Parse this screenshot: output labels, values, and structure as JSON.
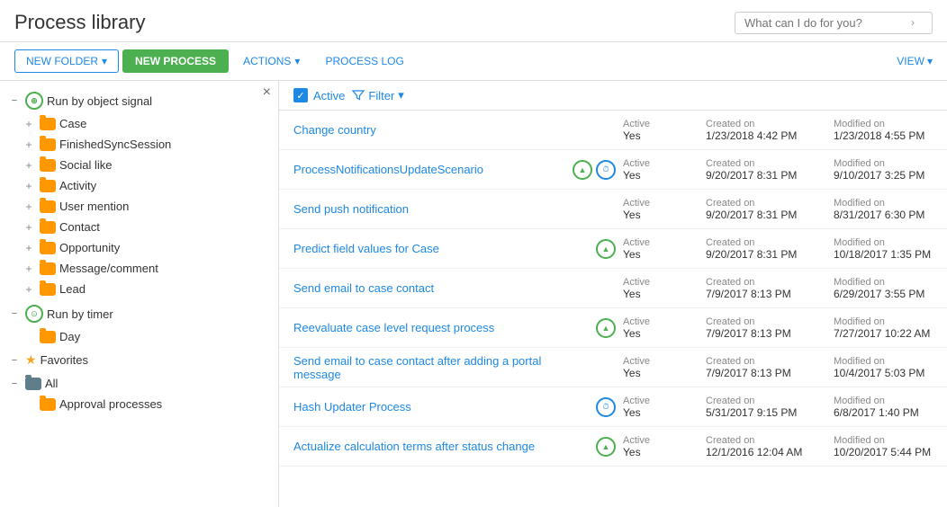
{
  "header": {
    "title": "Process library",
    "search_placeholder": "What can I do for you?"
  },
  "toolbar": {
    "new_folder": "NEW FOLDER",
    "new_process": "NEW PROCESS",
    "actions": "ACTIONS",
    "process_log": "PROCESS LOG",
    "view": "VIEW"
  },
  "filter": {
    "active_label": "Active",
    "filter_label": "Filter"
  },
  "sidebar": {
    "close_icon": "×",
    "groups": [
      {
        "id": "run-by-object-signal",
        "label": "Run by object signal",
        "expanded": true,
        "type": "signal",
        "children": [
          {
            "label": "Case"
          },
          {
            "label": "FinishedSyncSession"
          },
          {
            "label": "Social like"
          },
          {
            "label": "Activity"
          },
          {
            "label": "User mention"
          },
          {
            "label": "Contact"
          },
          {
            "label": "Opportunity"
          },
          {
            "label": "Message/comment"
          },
          {
            "label": "Lead"
          }
        ]
      },
      {
        "id": "run-by-timer",
        "label": "Run by timer",
        "expanded": true,
        "type": "timer",
        "children": [
          {
            "label": "Day"
          }
        ]
      },
      {
        "id": "favorites",
        "label": "Favorites",
        "type": "favorites",
        "expanded": false,
        "children": []
      },
      {
        "id": "all",
        "label": "All",
        "type": "all",
        "expanded": true,
        "children": [
          {
            "label": "Approval processes"
          }
        ]
      }
    ]
  },
  "processes": [
    {
      "name": "Change country",
      "icons": [],
      "active": "Yes",
      "created_label": "Created on",
      "created": "1/23/2018 4:42 PM",
      "modified_label": "Modified on",
      "modified": "1/23/2018 4:55 PM"
    },
    {
      "name": "ProcessNotificationsUpdateScenario",
      "icons": [
        "triangle-green",
        "clock-blue"
      ],
      "active": "Yes",
      "created_label": "Created on",
      "created": "9/20/2017 8:31 PM",
      "modified_label": "Modified on",
      "modified": "9/10/2017 3:25 PM"
    },
    {
      "name": "Send push notification",
      "icons": [],
      "active": "Yes",
      "created_label": "Created on",
      "created": "9/20/2017 8:31 PM",
      "modified_label": "Modified on",
      "modified": "8/31/2017 6:30 PM"
    },
    {
      "name": "Predict field values for Case",
      "icons": [
        "triangle-green"
      ],
      "active": "Yes",
      "created_label": "Created on",
      "created": "9/20/2017 8:31 PM",
      "modified_label": "Modified on",
      "modified": "10/18/2017 1:35 PM"
    },
    {
      "name": "Send email to case contact",
      "icons": [],
      "active": "Yes",
      "created_label": "Created on",
      "created": "7/9/2017 8:13 PM",
      "modified_label": "Modified on",
      "modified": "6/29/2017 3:55 PM"
    },
    {
      "name": "Reevaluate case level request process",
      "icons": [
        "triangle-green"
      ],
      "active": "Yes",
      "created_label": "Created on",
      "created": "7/9/2017 8:13 PM",
      "modified_label": "Modified on",
      "modified": "7/27/2017 10:22 AM"
    },
    {
      "name": "Send email to case contact after adding a portal message",
      "icons": [],
      "active": "Yes",
      "created_label": "Created on",
      "created": "7/9/2017 8:13 PM",
      "modified_label": "Modified on",
      "modified": "10/4/2017 5:03 PM"
    },
    {
      "name": "Hash Updater Process",
      "icons": [
        "clock-blue"
      ],
      "active": "Yes",
      "created_label": "Created on",
      "created": "5/31/2017 9:15 PM",
      "modified_label": "Modified on",
      "modified": "6/8/2017 1:40 PM"
    },
    {
      "name": "Actualize calculation terms after status change",
      "icons": [
        "triangle-green"
      ],
      "active": "Yes",
      "created_label": "Created on",
      "created": "12/1/2016 12:04 AM",
      "modified_label": "Modified on",
      "modified": "10/20/2017 5:44 PM"
    }
  ]
}
